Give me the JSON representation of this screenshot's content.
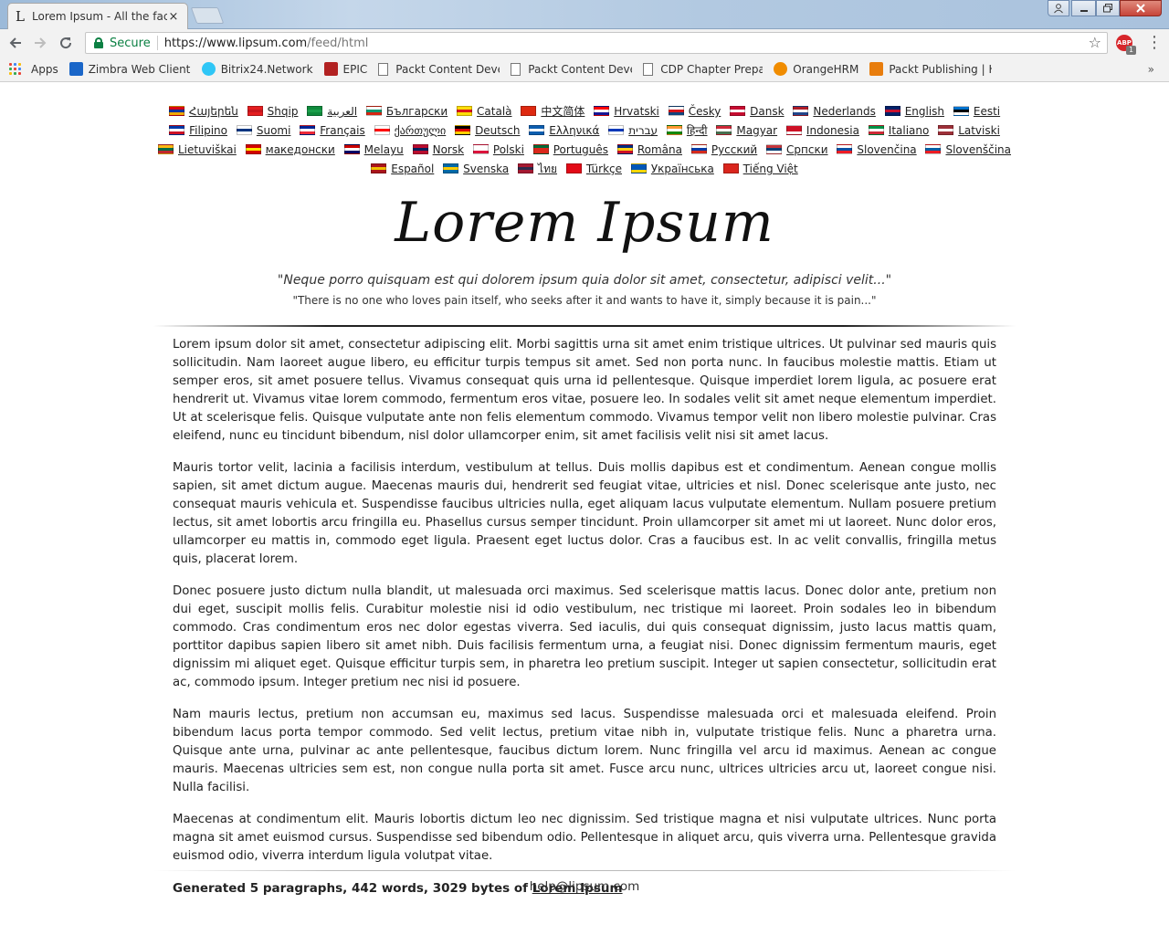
{
  "window": {
    "tab_title": "Lorem Ipsum - All the facts",
    "tab_favicon": "L",
    "close_glyph": "×"
  },
  "toolbar": {
    "secure_label": "Secure",
    "url_host": "https://www.lipsum.com",
    "url_path": "/feed/html",
    "abp_badge": "ABP",
    "abp_count": "1"
  },
  "bookmarks": [
    {
      "label": "Apps",
      "icon": "apps-grid-icon"
    },
    {
      "label": "Zimbra Web Client Si",
      "icon": "zimbra-icon",
      "color": "#1a66c8"
    },
    {
      "label": "Bitrix24.Network",
      "icon": "bitrix-icon",
      "color": "#2fc6f6"
    },
    {
      "label": "EPIC",
      "icon": "epic-icon",
      "color": "#b22222"
    },
    {
      "label": "Packt Content Develc",
      "icon": "page-icon"
    },
    {
      "label": "Packt Content Develc",
      "icon": "page-icon"
    },
    {
      "label": "CDP Chapter Prepare",
      "icon": "page-icon"
    },
    {
      "label": "OrangeHRM",
      "icon": "orangehrm-icon",
      "color": "#f08c00"
    },
    {
      "label": "Packt Publishing | He",
      "icon": "packt-icon",
      "color": "#e87d0d"
    }
  ],
  "languages": [
    {
      "label": "Հայերեն",
      "flag": [
        "#d90012",
        "#0033a0",
        "#f2a800"
      ]
    },
    {
      "label": "Shqip",
      "flag": [
        "#e41e20",
        "#c8161d",
        "#e41e20"
      ]
    },
    {
      "label": "العربية",
      "flag": [
        "#0f8a3c",
        "#1a9e4a",
        "#0f8a3c"
      ]
    },
    {
      "label": "Български",
      "flag": [
        "#ffffff",
        "#00966e",
        "#d62612"
      ]
    },
    {
      "label": "Català",
      "flag": [
        "#fcdd09",
        "#da121a",
        "#fcdd09"
      ]
    },
    {
      "label": "中文简体",
      "flag": [
        "#de2910",
        "#de2910",
        "#de2910"
      ]
    },
    {
      "label": "Hrvatski",
      "flag": [
        "#ff0000",
        "#ffffff",
        "#171796"
      ]
    },
    {
      "label": "Česky",
      "flag": [
        "#ffffff",
        "#d7141a",
        "#11457e"
      ]
    },
    {
      "label": "Dansk",
      "flag": [
        "#c60c30",
        "#ffffff",
        "#c60c30"
      ]
    },
    {
      "label": "Nederlands",
      "flag": [
        "#ae1c28",
        "#ffffff",
        "#21468b"
      ]
    },
    {
      "label": "English",
      "flag": [
        "#012169",
        "#c8102e",
        "#012169"
      ]
    },
    {
      "label": "Eesti",
      "flag": [
        "#0072ce",
        "#000000",
        "#ffffff"
      ]
    },
    {
      "label": "Filipino",
      "flag": [
        "#0038a8",
        "#ffffff",
        "#ce1126"
      ]
    },
    {
      "label": "Suomi",
      "flag": [
        "#ffffff",
        "#003580",
        "#ffffff"
      ]
    },
    {
      "label": "Français",
      "flag": [
        "#002395",
        "#ffffff",
        "#ed2939"
      ]
    },
    {
      "label": "ქართული",
      "flag": [
        "#ffffff",
        "#ff0000",
        "#ffffff"
      ]
    },
    {
      "label": "Deutsch",
      "flag": [
        "#000000",
        "#dd0000",
        "#ffce00"
      ]
    },
    {
      "label": "Ελληνικά",
      "flag": [
        "#0d5eaf",
        "#ffffff",
        "#0d5eaf"
      ]
    },
    {
      "label": "עברית",
      "flag": [
        "#ffffff",
        "#0038b8",
        "#ffffff"
      ]
    },
    {
      "label": "हिन्दी",
      "flag": [
        "#ff9933",
        "#ffffff",
        "#138808"
      ]
    },
    {
      "label": "Magyar",
      "flag": [
        "#ce2939",
        "#ffffff",
        "#477050"
      ]
    },
    {
      "label": "Indonesia",
      "flag": [
        "#ce1126",
        "#ce1126",
        "#ffffff"
      ]
    },
    {
      "label": "Italiano",
      "flag": [
        "#009246",
        "#ffffff",
        "#ce2b37"
      ]
    },
    {
      "label": "Latviski",
      "flag": [
        "#9e3039",
        "#ffffff",
        "#9e3039"
      ]
    },
    {
      "label": "Lietuviškai",
      "flag": [
        "#fdb913",
        "#006a44",
        "#c1272d"
      ]
    },
    {
      "label": "македонски",
      "flag": [
        "#d20000",
        "#ffe600",
        "#d20000"
      ]
    },
    {
      "label": "Melayu",
      "flag": [
        "#cc0001",
        "#ffffff",
        "#010066"
      ]
    },
    {
      "label": "Norsk",
      "flag": [
        "#ba0c2f",
        "#00205b",
        "#ba0c2f"
      ]
    },
    {
      "label": "Polski",
      "flag": [
        "#ffffff",
        "#ffffff",
        "#dc143c"
      ]
    },
    {
      "label": "Português",
      "flag": [
        "#046a38",
        "#da291c",
        "#da291c"
      ]
    },
    {
      "label": "Româna",
      "flag": [
        "#002b7f",
        "#fcd116",
        "#ce1126"
      ]
    },
    {
      "label": "Pyccкий",
      "flag": [
        "#ffffff",
        "#0039a6",
        "#d52b1e"
      ]
    },
    {
      "label": "Српски",
      "flag": [
        "#c6363c",
        "#0c4076",
        "#ffffff"
      ]
    },
    {
      "label": "Slovenčina",
      "flag": [
        "#ffffff",
        "#0b4ea2",
        "#ee1c25"
      ]
    },
    {
      "label": "Slovenščina",
      "flag": [
        "#ffffff",
        "#005da4",
        "#ed1c24"
      ]
    },
    {
      "label": "Español",
      "flag": [
        "#aa151b",
        "#f1bf00",
        "#aa151b"
      ]
    },
    {
      "label": "Svenska",
      "flag": [
        "#006aa7",
        "#fecc00",
        "#006aa7"
      ]
    },
    {
      "label": "ไทย",
      "flag": [
        "#a51931",
        "#2d2a4a",
        "#a51931"
      ]
    },
    {
      "label": "Türkçe",
      "flag": [
        "#e30a17",
        "#e30a17",
        "#e30a17"
      ]
    },
    {
      "label": "Українська",
      "flag": [
        "#0057b7",
        "#0057b7",
        "#ffd700"
      ]
    },
    {
      "label": "Tiếng Việt",
      "flag": [
        "#da251d",
        "#da251d",
        "#da251d"
      ]
    }
  ],
  "logo": "Lorem Ipsum",
  "quote_latin": "\"Neque porro quisquam est qui dolorem ipsum quia dolor sit amet, consectetur, adipisci velit...\"",
  "quote_english": "\"There is no one who loves pain itself, who seeks after it and wants to have it, simply because it is pain...\"",
  "paragraphs": [
    "Lorem ipsum dolor sit amet, consectetur adipiscing elit. Morbi sagittis urna sit amet enim tristique ultrices. Ut pulvinar sed mauris quis sollicitudin. Nam laoreet augue libero, eu efficitur turpis tempus sit amet. Sed non porta nunc. In faucibus molestie mattis. Etiam ut semper eros, sit amet posuere tellus. Vivamus consequat quis urna id pellentesque. Quisque imperdiet lorem ligula, ac posuere erat hendrerit ut. Vivamus vitae lorem commodo, fermentum eros vitae, posuere leo. In sodales velit sit amet neque elementum imperdiet. Ut at scelerisque felis. Quisque vulputate ante non felis elementum commodo. Vivamus tempor velit non libero molestie pulvinar. Cras eleifend, nunc eu tincidunt bibendum, nisl dolor ullamcorper enim, sit amet facilisis velit nisi sit amet lacus.",
    "Mauris tortor velit, lacinia a facilisis interdum, vestibulum at tellus. Duis mollis dapibus est et condimentum. Aenean congue mollis sapien, sit amet dictum augue. Maecenas mauris dui, hendrerit sed feugiat vitae, ultricies et nisl. Donec scelerisque ante justo, nec consequat mauris vehicula et. Suspendisse faucibus ultricies nulla, eget aliquam lacus vulputate elementum. Nullam posuere pretium lectus, sit amet lobortis arcu fringilla eu. Phasellus cursus semper tincidunt. Proin ullamcorper sit amet mi ut laoreet. Nunc dolor eros, ullamcorper eu mattis in, commodo eget ligula. Praesent eget luctus dolor. Cras a faucibus est. In ac velit convallis, fringilla metus quis, placerat lorem.",
    "Donec posuere justo dictum nulla blandit, ut malesuada orci maximus. Sed scelerisque mattis lacus. Donec dolor ante, pretium non dui eget, suscipit mollis felis. Curabitur molestie nisi id odio vestibulum, nec tristique mi laoreet. Proin sodales leo in bibendum commodo. Cras condimentum eros nec dolor egestas viverra. Sed iaculis, dui quis consequat dignissim, justo lacus mattis quam, porttitor dapibus sapien libero sit amet nibh. Duis facilisis fermentum urna, a feugiat nisi. Donec dignissim fermentum mauris, eget dignissim mi aliquet eget. Quisque efficitur turpis sem, in pharetra leo pretium suscipit. Integer ut sapien consectetur, sollicitudin erat ac, commodo ipsum. Integer pretium nec nisi id posuere.",
    "Nam mauris lectus, pretium non accumsan eu, maximus sed lacus. Suspendisse malesuada orci et malesuada eleifend. Proin bibendum lacus porta tempor commodo. Sed velit lectus, pretium vitae nibh in, vulputate tristique felis. Nunc a pharetra urna. Quisque ante urna, pulvinar ac ante pellentesque, faucibus dictum lorem. Nunc fringilla vel arcu id maximus. Aenean ac congue mauris. Maecenas ultricies sem est, non congue nulla porta sit amet. Fusce arcu nunc, ultrices ultricies arcu ut, laoreet congue nisi. Nulla facilisi.",
    "Maecenas at condimentum elit. Mauris lobortis dictum leo nec dignissim. Sed tristique magna et nisi vulputate ultrices. Nunc porta magna sit amet euismod cursus. Suspendisse sed bibendum odio. Pellentesque in aliquet arcu, quis viverra urna. Pellentesque gravida euismod odio, viverra interdum ligula volutpat vitae."
  ],
  "generated": {
    "prefix": "Generated 5 paragraphs, 442 words, 3029 bytes of ",
    "link": "Lorem Ipsum"
  },
  "footer_email": "help@lipsum.com",
  "colors": {
    "secure_green": "#0b8043",
    "abp_red": "#d7262b"
  }
}
